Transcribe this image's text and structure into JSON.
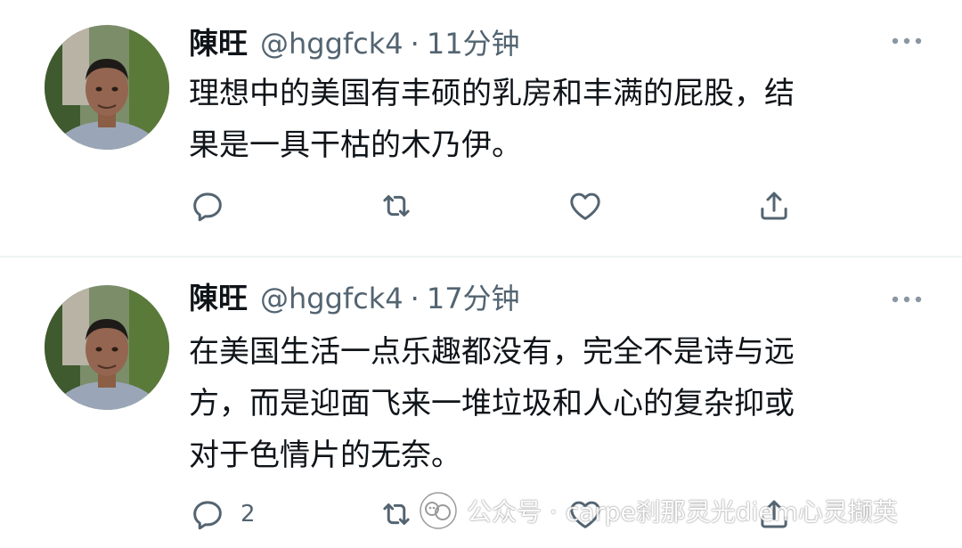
{
  "tweets": [
    {
      "display_name": "陳旺",
      "handle": "@hggfck4",
      "separator": "·",
      "time": "11分钟",
      "text_lines": [
        "理想中的美国有丰硕的乳房和丰满的屁股，结",
        "果是一具干枯的木乃伊。"
      ],
      "actions": {
        "reply_count": "",
        "retweet_count": "",
        "like_count": ""
      }
    },
    {
      "display_name": "陳旺",
      "handle": "@hggfck4",
      "separator": "·",
      "time": "17分钟",
      "text_lines": [
        "在美国生活一点乐趣都没有，完全不是诗与远",
        "方，而是迎面飞来一堆垃圾和人心的复杂抑或",
        "对于色情片的无奈。"
      ],
      "actions": {
        "reply_count": "2",
        "retweet_count": "",
        "like_count": ""
      }
    }
  ],
  "watermark": {
    "text": "公众号 · carpe刹那灵光diem心灵撷英",
    "icon": "wechat-official-account-icon"
  },
  "icons": {
    "reply": "reply-icon",
    "retweet": "retweet-icon",
    "like": "heart-icon",
    "share": "share-icon",
    "more": "more-dots-icon"
  },
  "colors": {
    "text_primary": "#0f1419",
    "text_secondary": "#536471",
    "divider": "#eff3f4"
  }
}
